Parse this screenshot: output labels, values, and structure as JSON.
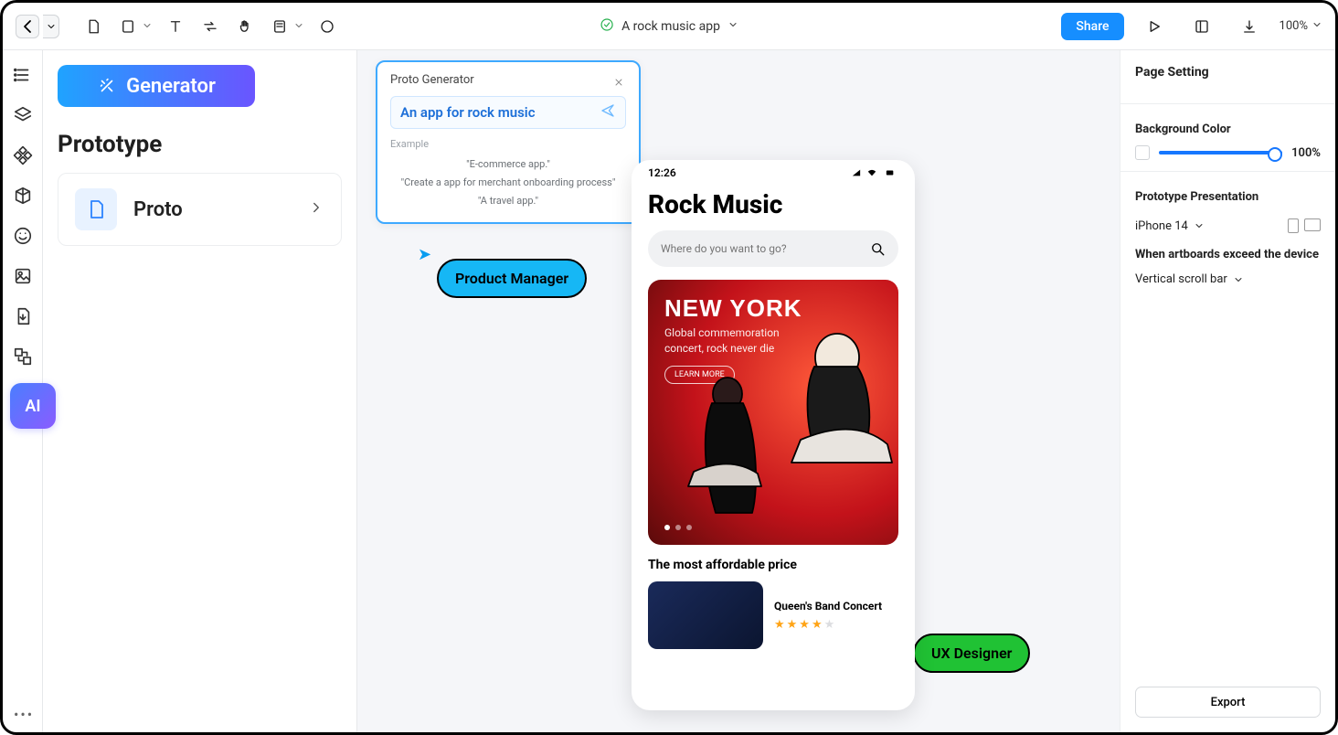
{
  "topbar": {
    "project_title": "A rock music app",
    "share_label": "Share",
    "zoom_label": "100%"
  },
  "leftrail": {
    "ai_label": "AI"
  },
  "leftpanel": {
    "generator_label": "Generator",
    "section_title": "Prototype",
    "proto_item": {
      "name": "Proto"
    }
  },
  "generator": {
    "title": "Proto Generator",
    "prompt_value": "An app for rock music",
    "example_label": "Example",
    "examples": [
      "\"E-commerce app.\"",
      "\"Create a app for merchant onboarding process\"",
      "\"A travel app.\""
    ]
  },
  "collaborators": [
    "Product Manager",
    "UX Designer"
  ],
  "phone": {
    "time": "12:26",
    "title": "Rock Music",
    "search_placeholder": "Where do you want to go?",
    "hero": {
      "title": "NEW YORK",
      "subtitle": "Global commemoration concert, rock never die",
      "button": "LEARN MORE"
    },
    "section_label": "The most affordable price",
    "item": {
      "name": "Queen's Band Concert",
      "rating": 4
    }
  },
  "right": {
    "heading": "Page Setting",
    "bg_label": "Background Color",
    "bg_opacity": "100%",
    "presentation_label": "Prototype Presentation",
    "device": "iPhone 14",
    "exceed_label": "When artboards exceed the device",
    "scroll_value": "Vertical scroll bar",
    "export_label": "Export"
  }
}
